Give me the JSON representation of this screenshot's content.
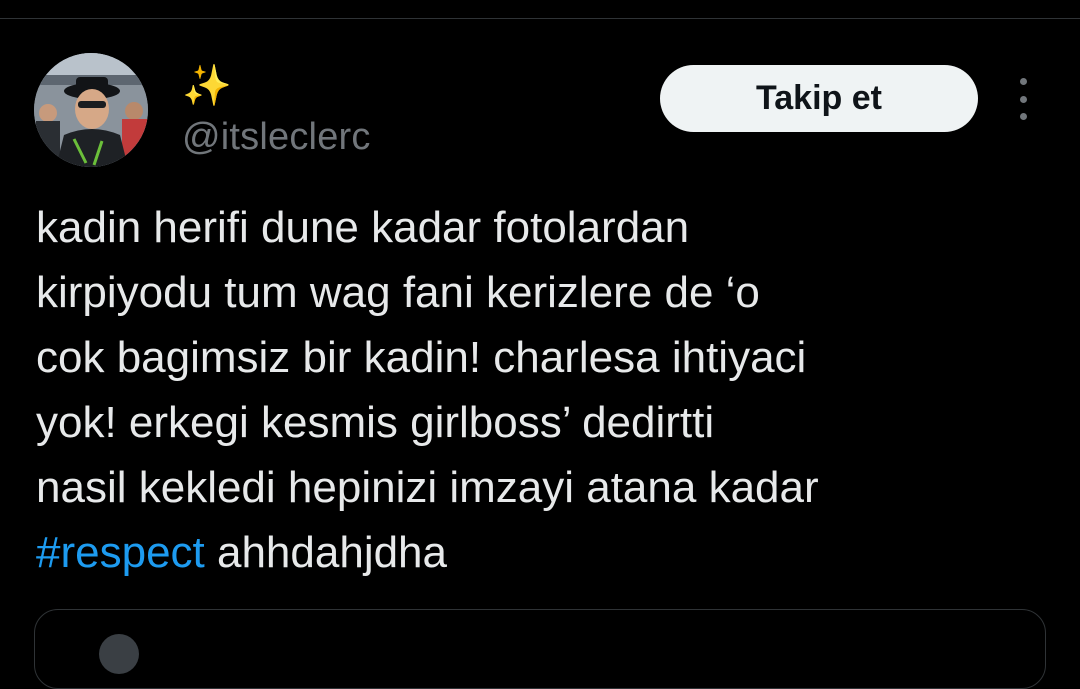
{
  "author": {
    "display_name": "✨",
    "handle": "@itsleclerc",
    "avatar_icon": "profile-photo"
  },
  "actions": {
    "follow_label": "Takip et",
    "more_icon": "more-vertical-icon"
  },
  "tweet": {
    "lines": [
      "kadin herifi dune kadar fotolardan",
      "kirpiyodu tum wag fani kerizlere de ‘o",
      "cok bagimsiz bir kadin! charlesa ihtiyaci",
      "yok! erkegi kesmis girlboss’ dedirtti",
      "nasil kekledi hepinizi imzayi atana kadar"
    ],
    "last_line": {
      "hashtag": "#respect",
      "text": " ahhdahjdha"
    }
  },
  "colors": {
    "background": "#000000",
    "text": "#e7e9ea",
    "secondary_text": "#71767b",
    "hashtag": "#1d9bf0",
    "follow_button_bg": "#eff3f4",
    "divider": "#2f3336"
  }
}
